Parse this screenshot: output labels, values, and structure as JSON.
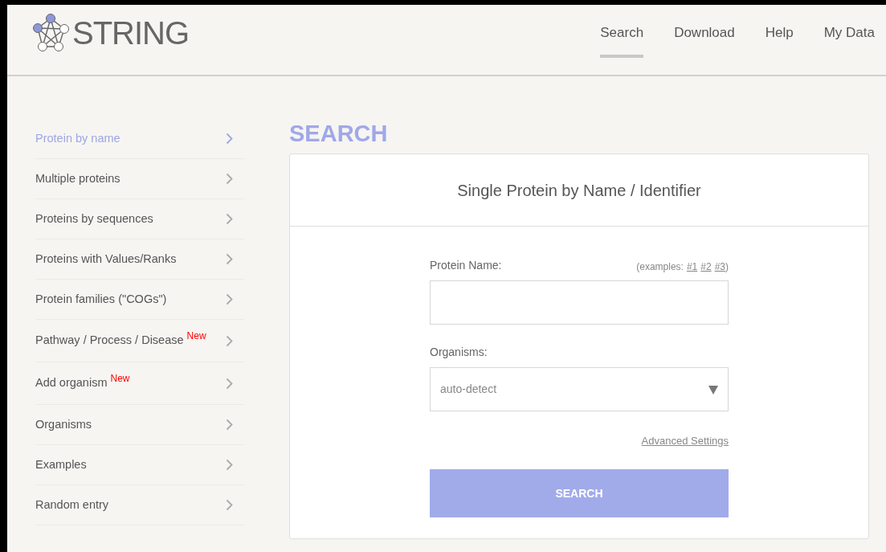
{
  "logo": {
    "text": "STRING"
  },
  "nav": [
    {
      "label": "Search",
      "selected": true
    },
    {
      "label": "Download",
      "selected": false
    },
    {
      "label": "Help",
      "selected": false
    },
    {
      "label": "My Data",
      "selected": false
    }
  ],
  "sidebar": {
    "items": [
      {
        "label": "Protein by name",
        "selected": true
      },
      {
        "label": "Multiple proteins",
        "selected": false
      },
      {
        "label": "Proteins by sequences",
        "selected": false
      },
      {
        "label": "Proteins with Values/Ranks",
        "selected": false
      },
      {
        "label": "Protein families (\"COGs\")",
        "selected": false
      },
      {
        "label": "Pathway / Process / Disease",
        "tag": "New",
        "selected": false
      },
      {
        "label": "Add organism",
        "tag": "New",
        "selected": false
      },
      {
        "label": "Organisms",
        "selected": false
      },
      {
        "label": "Examples",
        "selected": false
      },
      {
        "label": "Random entry",
        "selected": false
      }
    ]
  },
  "main": {
    "heading": "SEARCH",
    "card": {
      "title": "Single Protein by Name / Identifier",
      "protein_name": {
        "label": "Protein Name:",
        "examples_prefix": "(examples:",
        "example_links": [
          "#1",
          "#2",
          "#3"
        ],
        "examples_suffix": ")"
      },
      "organisms": {
        "label": "Organisms:",
        "value": "auto-detect"
      },
      "advanced_link": "Advanced Settings",
      "submit_button": "SEARCH"
    }
  }
}
